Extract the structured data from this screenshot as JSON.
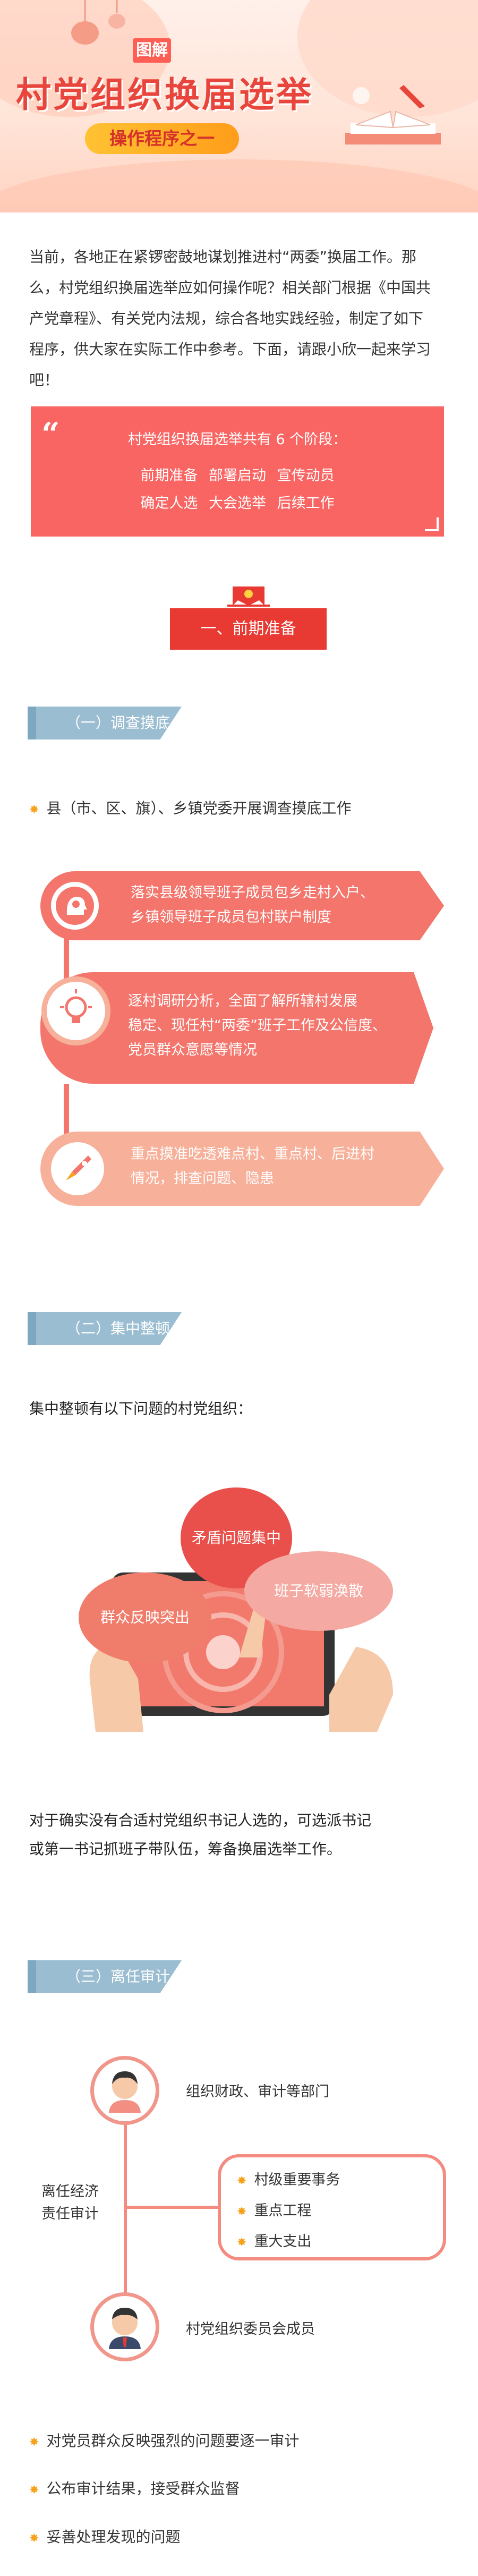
{
  "banner": {
    "badge": "图解",
    "title": "村党组织换届选举",
    "subtitle": "操作程序之一"
  },
  "intro": {
    "lines": [
      "当前，各地正在紧锣密鼓地谋划推进村“两委”换届工作。那",
      "么，村党组织换届选举应如何操作呢？相关部门根据《中国共",
      "产党章程》、有关党内法规，综合各地实践经验，制定了如下",
      "程序，供大家在实际工作中参考。下面，请跟小欣一起来学习",
      "吧！"
    ]
  },
  "quote": {
    "title": "村党组织换届选举共有 6 个阶段：",
    "row1": "前期准备  部署启动  宣传动员",
    "row2": "确定人选  大会选举  后续工作"
  },
  "section1": {
    "label": "一、前期准备"
  },
  "sub1": {
    "label": "（一）调查摸底",
    "bullet": "县（市、区、旗）、乡镇党委开展调查摸底工作",
    "cards": [
      {
        "lines": [
          "落实县级领导班子成员包乡走村入户、",
          "乡镇领导班子成员包村联户制度"
        ]
      },
      {
        "lines": [
          "逐村调研分析，全面了解所辖村发展",
          "稳定、现任村“两委”班子工作及公信度、",
          "党员群众意愿等情况"
        ]
      },
      {
        "lines": [
          "重点摸准吃透难点村、重点村、后进村",
          "情况，排查问题、隐患"
        ]
      }
    ]
  },
  "sub2": {
    "label": "（二）集中整顿",
    "intro": "集中整顿有以下问题的村党组织：",
    "clouds": [
      "矛盾问题集中",
      "班子软弱涣散",
      "群众反映突出"
    ],
    "para_lines": [
      "对于确实没有合适村党组织书记人选的，可选派书记",
      "或第一书记抓班子带队伍，筹备换届选举工作。"
    ]
  },
  "sub3": {
    "label": "（三）离任审计",
    "top_label": "组织财政、审计等部门",
    "left_label_lines": [
      "离任经济",
      "责任审计"
    ],
    "items": [
      "村级重要事务",
      "重点工程",
      "重大支出"
    ],
    "bottom_label": "村党组织委员会成员",
    "bullets": [
      "对党员群众反映强烈的问题要逐一审计",
      "公布审计结果，接受群众监督",
      "妥善处理发现的问题"
    ]
  },
  "colors": {
    "accent": "#e83a33",
    "card": "#f3756c",
    "tab": "#9bbdd1",
    "star": "#f7a21b"
  }
}
